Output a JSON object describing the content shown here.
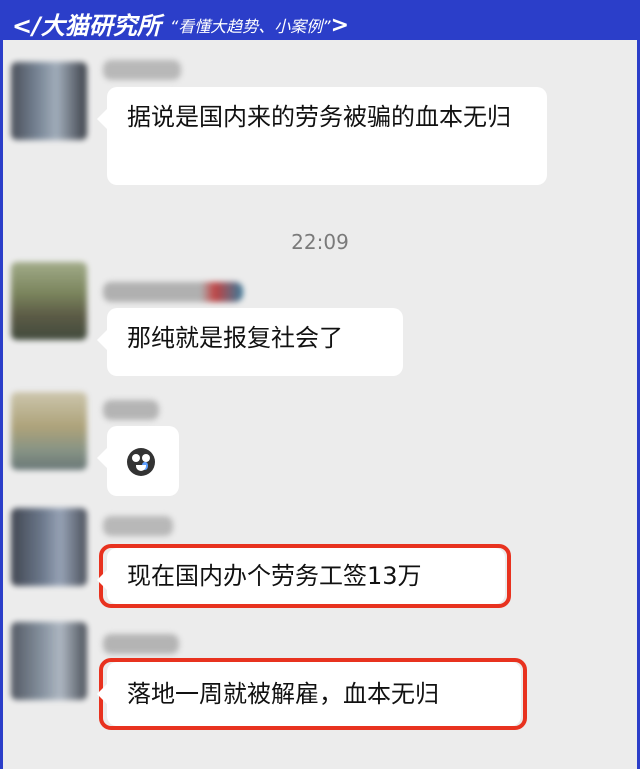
{
  "header": {
    "brand": "</大猫研究所",
    "slogan": "“看懂大趋势、小案例”",
    "arrow": ">"
  },
  "messages": [
    {
      "text": "据说是国内来的劳务被骗的血本无归",
      "highlighted": false
    },
    {
      "text": "那纯就是报复社会了",
      "highlighted": false
    },
    {
      "text": "",
      "emoji": "crying-face-icon",
      "highlighted": false
    },
    {
      "text": "现在国内办个劳务工签13万",
      "highlighted": true
    },
    {
      "text": "落地一周就被解雇，血本无归",
      "highlighted": true
    }
  ],
  "timestamp": "22:09",
  "colors": {
    "header_bg": "#2b3ec9",
    "chat_bg": "#ececec",
    "highlight": "#e8321f"
  }
}
